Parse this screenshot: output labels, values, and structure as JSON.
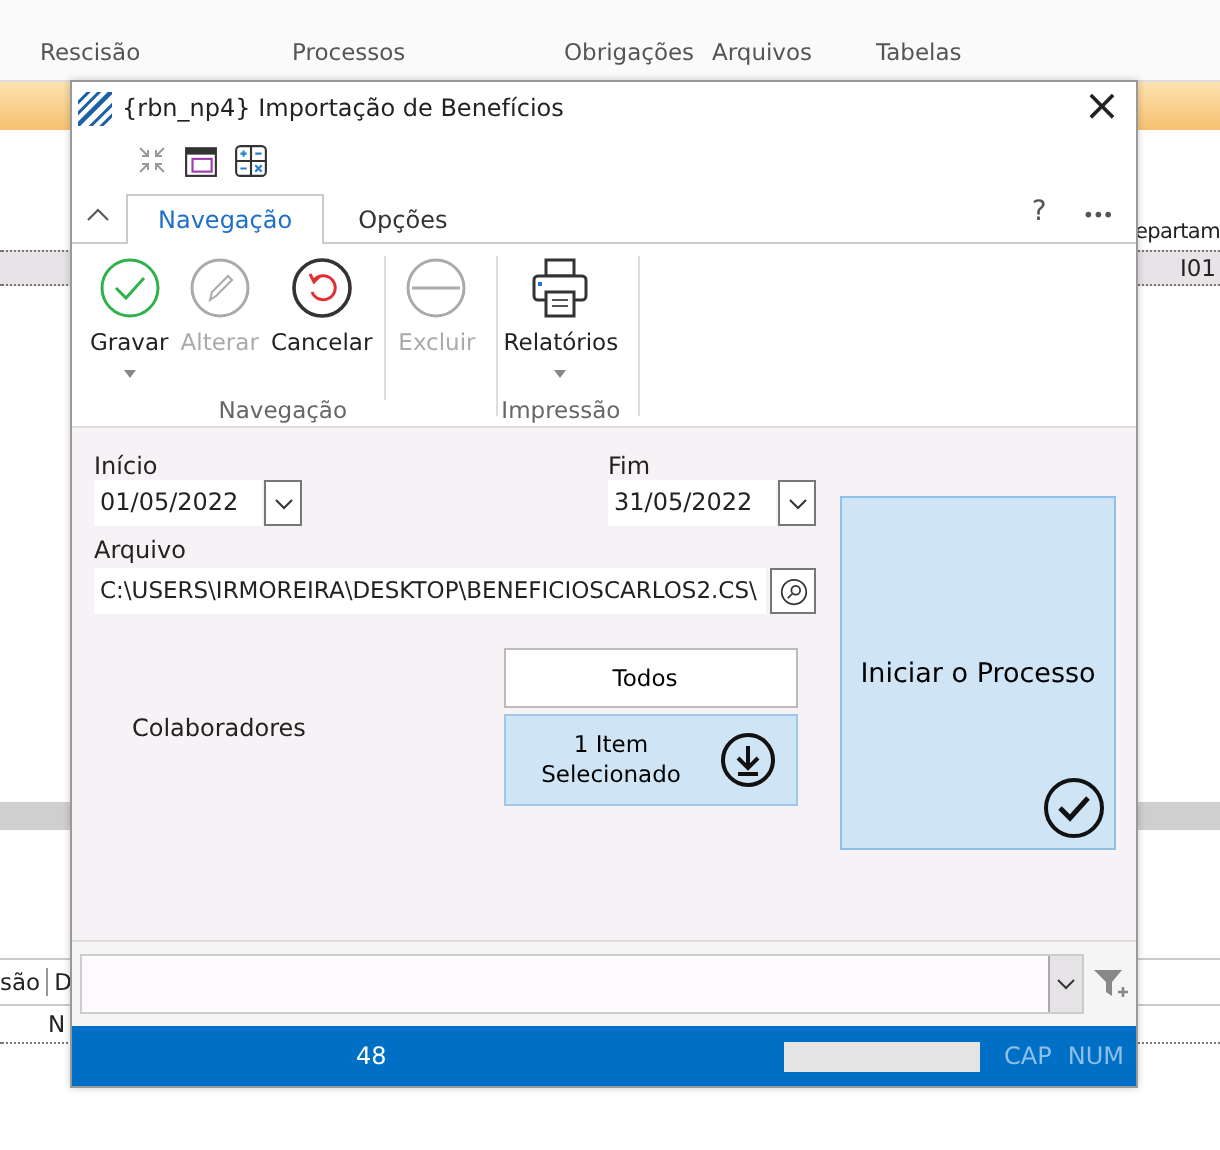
{
  "background": {
    "ribbon_groups": [
      "Rescisão",
      "Processos",
      "Obrigações",
      "Arquivos",
      "Tabelas"
    ],
    "right_column_header": "epartam",
    "right_cell": "I01",
    "left_column_headers": [
      "são",
      "D"
    ],
    "left_cell": "N"
  },
  "window": {
    "title": "{rbn_np4}  Importação de Benefícios",
    "close": "×"
  },
  "tabs": [
    {
      "label": "Navegação",
      "selected": true
    },
    {
      "label": "Opções",
      "selected": false
    }
  ],
  "help": "?",
  "more": "•••",
  "ribbon": [
    {
      "label": "Navegação",
      "buttons": [
        {
          "kind": "save",
          "label": "Gravar",
          "disabled": false,
          "dropdown": true
        },
        {
          "kind": "edit",
          "label": "Alterar",
          "disabled": true,
          "dropdown": false
        },
        {
          "kind": "cancel",
          "label": "Cancelar",
          "disabled": false,
          "dropdown": false
        },
        {
          "kind": "delete",
          "label": "Excluir",
          "disabled": true,
          "dropdown": false
        }
      ]
    },
    {
      "label": "Impressão",
      "buttons": [
        {
          "kind": "print",
          "label": "Relatórios",
          "disabled": false,
          "dropdown": true
        }
      ]
    }
  ],
  "form": {
    "start": {
      "label": "Início",
      "value": "01/05/2022"
    },
    "end": {
      "label": "Fim",
      "value": "31/05/2022"
    },
    "file": {
      "label": "Arquivo",
      "value": "C:\\USERS\\IRMOREIRA\\DESKTOP\\BENEFICIOSCARLOS2.CS\\"
    },
    "collaborators": {
      "label": "Colaboradores",
      "options": [
        {
          "label": "Todos",
          "selected": false
        },
        {
          "label": "1 Item\nSelecionado",
          "selected": true
        }
      ]
    },
    "start_button": "Iniciar o Processo"
  },
  "status_bar": {
    "count": "48",
    "indicators": [
      "CAP",
      "NUM"
    ]
  }
}
